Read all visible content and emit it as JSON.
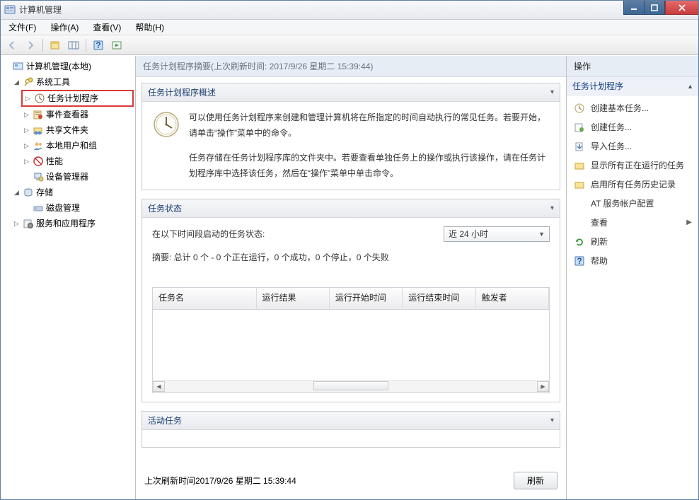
{
  "window": {
    "title": "计算机管理"
  },
  "menu": {
    "file": "文件(F)",
    "action": "操作(A)",
    "view": "查看(V)",
    "help": "帮助(H)"
  },
  "tree": {
    "root": "计算机管理(本地)",
    "system_tools": "系统工具",
    "task_scheduler": "任务计划程序",
    "event_viewer": "事件查看器",
    "shared_folders": "共享文件夹",
    "local_users_groups": "本地用户和组",
    "performance": "性能",
    "device_manager": "设备管理器",
    "storage": "存储",
    "disk_mgmt": "磁盘管理",
    "services_apps": "服务和应用程序"
  },
  "center": {
    "header": "任务计划程序摘要(上次刷新时间: 2017/9/26 星期二 15:39:44)",
    "overview_title": "任务计划程序概述",
    "overview_p1": "可以使用任务计划程序来创建和管理计算机将在所指定的时间自动执行的常见任务。若要开始，请单击“操作”菜单中的命令。",
    "overview_p2": "任务存储在任务计划程序库的文件夹中。若要查看单独任务上的操作或执行该操作，请在任务计划程序库中选择该任务，然后在“操作”菜单中单击命令。",
    "status_title": "任务状态",
    "status_label": "在以下时间段启动的任务状态:",
    "status_dropdown": "近 24 小时",
    "summary_line": "摘要: 总计 0 个 - 0 个正在运行，0 个成功，0 个停止，0 个失败",
    "cols": {
      "name": "任务名",
      "result": "运行结果",
      "start": "运行开始时间",
      "end": "运行结束时间",
      "trigger": "触发者"
    },
    "active_title": "活动任务",
    "last_refresh": "上次刷新时间2017/9/26 星期二 15:39:44",
    "refresh_btn": "刷新"
  },
  "actions": {
    "header": "操作",
    "section": "任务计划程序",
    "items": {
      "create_basic": "创建基本任务...",
      "create_task": "创建任务...",
      "import_task": "导入任务...",
      "show_running": "显示所有正在运行的任务",
      "enable_history": "启用所有任务历史记录",
      "at_account": "AT 服务帐户配置",
      "view": "查看",
      "refresh": "刷新",
      "help": "帮助"
    }
  }
}
